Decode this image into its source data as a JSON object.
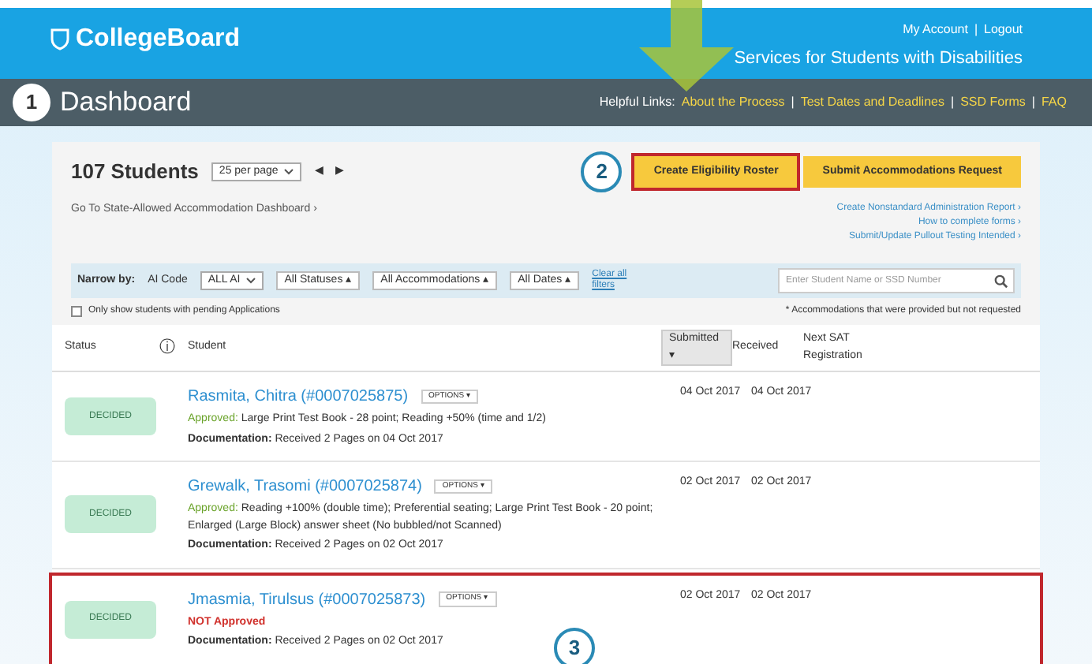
{
  "header": {
    "logo": "CollegeBoard",
    "account_links": [
      "My Account",
      "Logout"
    ],
    "account_separator": "|",
    "site_title": "Services for Students with Disabilities"
  },
  "title_bar": {
    "step": "1",
    "title": "Dashboard",
    "links_label": "Helpful Links:",
    "links": [
      "About the Process",
      "Test Dates and Deadlines",
      "SSD Forms",
      "FAQ"
    ],
    "separator": "|"
  },
  "toolbar": {
    "count": "107 Students",
    "per_page": "25 per page",
    "prev": "◀",
    "next": "▶",
    "step": "2",
    "buttons": [
      {
        "label": "Create Eligibility Roster",
        "highlighted": true
      },
      {
        "label": "Submit Accommodations Request",
        "highlighted": false
      }
    ]
  },
  "dashboard_link": "Go To State-Allowed Accommodation Dashboard ›",
  "side_links": [
    "Create Nonstandard Administration Report ›",
    "How to complete forms ›",
    "Submit/Update Pullout Testing Intended ›"
  ],
  "filters": {
    "label": "Narrow by:",
    "ai_code_label": "AI Code",
    "ai_code": "ALL AI",
    "dropdowns": [
      "All Statuses ▴",
      "All Accommodations ▴",
      "All Dates ▴"
    ],
    "clear": "Clear all filters",
    "search": {
      "placeholder": "Enter Student Name or SSD Number"
    }
  },
  "pending_only": {
    "label": "Only show students with pending Applications",
    "checked": false
  },
  "footnote": "* Accommodations that were provided but not requested",
  "table": {
    "columns": [
      {
        "label": "Status",
        "sorted": false
      },
      {
        "label": "ⓘ",
        "sorted": false
      },
      {
        "label": "Student",
        "sorted": false
      },
      {
        "label": "Submitted ▾",
        "sorted": true
      },
      {
        "label": "Received",
        "sorted": false
      },
      {
        "label": "Next SAT Registration",
        "sorted": false
      }
    ],
    "rows": [
      {
        "status": "DECIDED",
        "name": "Rasmita, Chitra (#0007025875)",
        "options": "OPTIONS ▾",
        "approved": true,
        "approval_label": "Approved:",
        "approval_detail": "Large Print Test Book - 28 point; Reading +50% (time and 1/2)",
        "documentation": "**Documentation:** Received 2 Pages on 04 Oct 2017",
        "submitted": "04 Oct 2017",
        "received": "04 Oct 2017",
        "highlighted": false
      },
      {
        "status": "DECIDED",
        "name": "Grewalk, Trasomi (#0007025874)",
        "options": "OPTIONS ▾",
        "approved": true,
        "approval_label": "Approved:",
        "approval_detail": "Reading +100% (double time); Preferential seating; Large Print Test Book - 20 point; Enlarged (Large Block) answer sheet (No bubbled/not Scanned)",
        "documentation": "**Documentation:** Received 2 Pages on 02 Oct 2017",
        "submitted": "02 Oct 2017",
        "received": "02 Oct 2017",
        "highlighted": false
      },
      {
        "status": "DECIDED",
        "name": "Jmasmia, Tirulsus (#0007025873)",
        "options": "OPTIONS ▾",
        "approved": false,
        "approval_label": "NOT Approved",
        "approval_detail": "",
        "documentation": "**Documentation:** Received 2 Pages on 02 Oct 2017",
        "submitted": "02 Oct 2017",
        "received": "02 Oct 2017",
        "highlighted": true
      }
    ]
  },
  "row_callout": "3"
}
